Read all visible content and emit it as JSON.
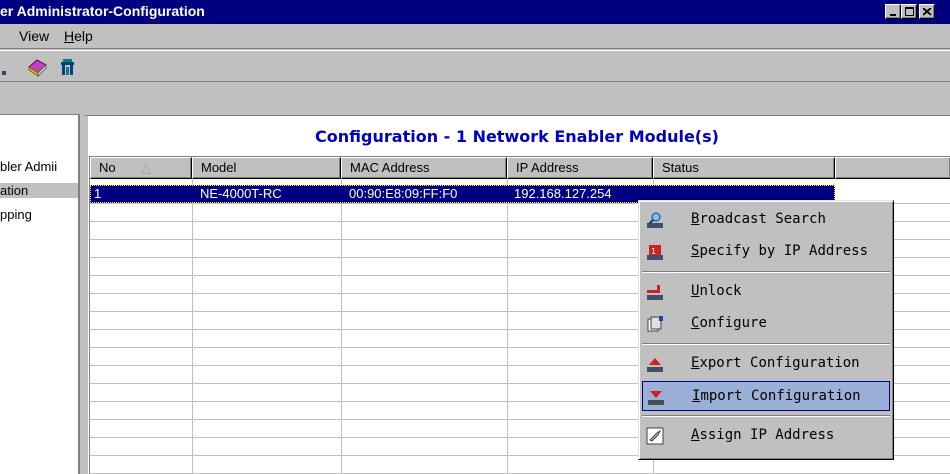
{
  "window": {
    "title": "er Administrator-Configuration"
  },
  "menu": {
    "view": "View",
    "help_h": "H",
    "help_rest": "elp"
  },
  "toolbar": {
    "icons": [
      "left-partial-icon",
      "book-icon",
      "network-plug-icon"
    ]
  },
  "tree": {
    "items": [
      "bler Admii",
      "ation",
      "pping"
    ]
  },
  "main": {
    "header": "Configuration - 1 Network Enabler Module(s)",
    "columns": [
      "No",
      "Model",
      "MAC Address",
      "IP Address",
      "Status"
    ],
    "sort_indicator": "△",
    "rows": [
      {
        "no": "1",
        "model": "NE-4000T-RC",
        "mac": "00:90:E8:09:FF:F0",
        "ip": "192.168.127.254",
        "status": ""
      }
    ]
  },
  "context_menu": {
    "items": [
      {
        "key": "B",
        "rest": "roadcast Search",
        "icon": "search-icon"
      },
      {
        "key": "S",
        "rest": "pecify by IP Address",
        "icon": "red-device-icon"
      },
      {
        "key": "U",
        "rest": "nlock",
        "icon": "unlock-icon"
      },
      {
        "key": "C",
        "rest": "onfigure",
        "icon": "configure-icon"
      },
      {
        "key": "E",
        "rest": "xport Configuration",
        "icon": "export-icon"
      },
      {
        "key": "I",
        "rest": "mport Configuration",
        "icon": "import-icon"
      },
      {
        "key": "A",
        "rest": "ssign IP Address",
        "icon": "assign-ip-icon"
      }
    ]
  },
  "colors": {
    "title_bar": "#000080",
    "header_text": "#0000c0",
    "highlight": "#9ab0d6"
  }
}
